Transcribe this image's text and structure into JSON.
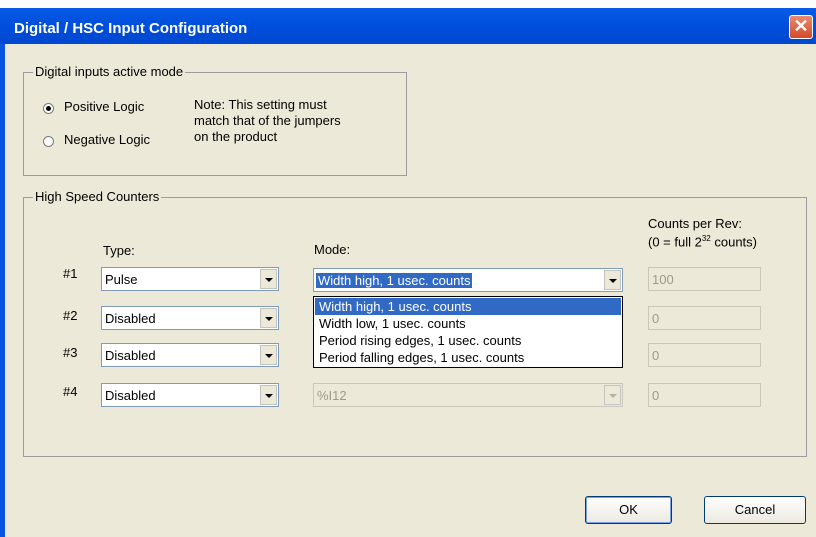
{
  "window": {
    "title": "Digital / HSC Input Configuration",
    "close_label": "✕"
  },
  "active_mode": {
    "legend": "Digital inputs active mode",
    "options": [
      {
        "label": "Positive Logic",
        "selected": true
      },
      {
        "label": "Negative Logic",
        "selected": false
      }
    ],
    "note": [
      "Note: This setting must",
      "match that of the jumpers",
      "on the product"
    ]
  },
  "hsc": {
    "legend": "High Speed Counters",
    "headers": {
      "type": "Type:",
      "mode": "Mode:",
      "counts_line1": "Counts per Rev:",
      "counts_line2_prefix": "(0 = full 2",
      "counts_line2_sup": "32",
      "counts_line2_suffix": " counts)"
    },
    "rows": [
      {
        "label": "#1",
        "type": "Pulse",
        "mode": "Width high, 1 usec. counts",
        "counts": "100"
      },
      {
        "label": "#2",
        "type": "Disabled",
        "mode": "",
        "counts": "0"
      },
      {
        "label": "#3",
        "type": "Disabled",
        "mode": "",
        "counts": "0"
      },
      {
        "label": "#4",
        "type": "Disabled",
        "mode": "%I12",
        "counts": "0"
      }
    ],
    "mode_dropdown": {
      "options": [
        "Width high, 1 usec. counts",
        "Width low, 1 usec. counts",
        "Period rising edges, 1 usec. counts",
        "Period falling edges, 1 usec. counts"
      ],
      "selected_index": 0
    }
  },
  "buttons": {
    "ok": "OK",
    "cancel": "Cancel"
  }
}
